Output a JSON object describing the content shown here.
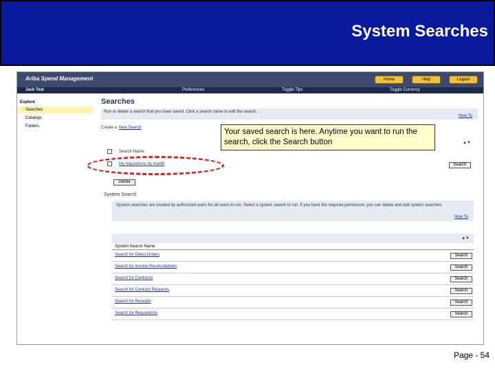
{
  "slide": {
    "title": "System Searches",
    "page": "Page - 54"
  },
  "app": {
    "logo": "Ariba Spend Management",
    "top_buttons": [
      "Home",
      "Help",
      "Logout"
    ],
    "user": "Jack Test",
    "nav": [
      "Preferences",
      "Toggle Tips",
      "Toggle Currency"
    ]
  },
  "sidebar": {
    "heading": "Explore",
    "items": [
      "Searches",
      "Catalogs",
      "Folders"
    ]
  },
  "main": {
    "title": "Searches",
    "intro": "Run or delete a search that you have saved. Click a search name to edit the search.",
    "how_to": "How To",
    "create_prefix": "Create a",
    "create_link": "New Search",
    "col_header": "Search Name",
    "saved_item": "My requisitions by month",
    "delete_label": "Delete",
    "search_label": "Search",
    "system_title": "System Search",
    "system_intro": "System searches are created by authorized users for all users to run. Select a system search to run. If you have the required permission, you can delete and edit system searches.",
    "system_col": "System Search Name",
    "system_rows": [
      "Search for Direct Orders",
      "Search for Invoice Reconciliations",
      "Search for Contracts",
      "Search for Contract Requests",
      "Search for Receipts",
      "Search for Requisitions"
    ]
  },
  "callout": {
    "text": "Your saved search is here.  Anytime you want to run the search, click the Search button"
  },
  "colors": {
    "banner": "#0a1a9c",
    "callout_bg": "#ffffcc",
    "highlight": "#e02020"
  }
}
